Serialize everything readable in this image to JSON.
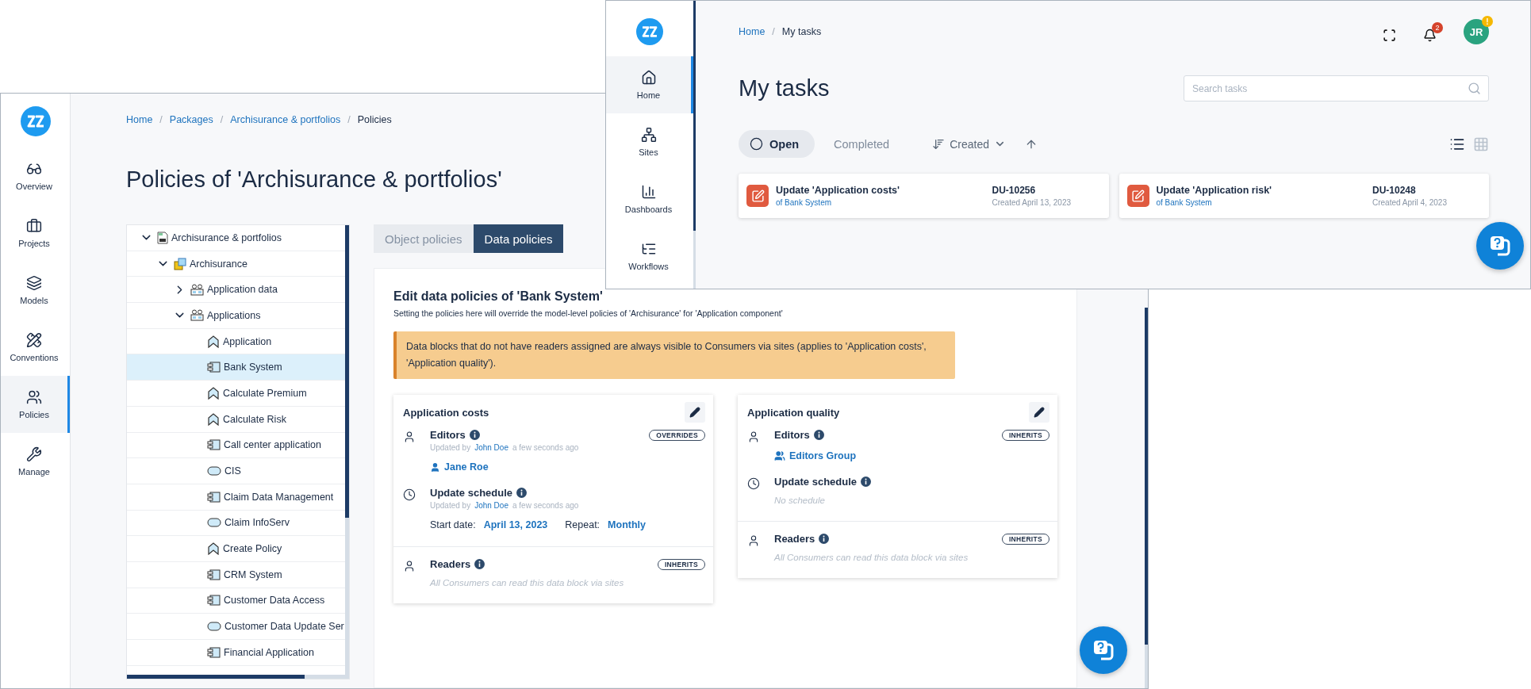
{
  "back_window": {
    "sidebar": {
      "items": [
        {
          "label": "Overview",
          "selected": false
        },
        {
          "label": "Projects",
          "selected": false
        },
        {
          "label": "Models",
          "selected": false
        },
        {
          "label": "Conventions",
          "selected": false
        },
        {
          "label": "Policies",
          "selected": true
        },
        {
          "label": "Manage",
          "selected": false
        }
      ]
    },
    "breadcrumb": {
      "separator": "/",
      "items": [
        "Home",
        "Packages",
        "Archisurance & portfolios",
        "Policies"
      ]
    },
    "title": "Policies of 'Archisurance & portfolios'",
    "tree": [
      {
        "label": "Archisurance & portfolios",
        "kind": "package",
        "expanded": true,
        "selected": false,
        "children": [
          {
            "label": "Archisurance",
            "kind": "model",
            "expanded": true,
            "selected": false,
            "children": [
              {
                "label": "Application data",
                "kind": "folder",
                "expanded": false,
                "selected": false
              },
              {
                "label": "Applications",
                "kind": "folder",
                "expanded": true,
                "selected": false,
                "children": [
                  {
                    "label": "Application",
                    "kind": "function",
                    "selected": false
                  },
                  {
                    "label": "Bank System",
                    "kind": "component",
                    "selected": true
                  },
                  {
                    "label": "Calculate Premium",
                    "kind": "function",
                    "selected": false
                  },
                  {
                    "label": "Calculate Risk",
                    "kind": "function",
                    "selected": false
                  },
                  {
                    "label": "Call center application",
                    "kind": "component",
                    "selected": false
                  },
                  {
                    "label": "CIS",
                    "kind": "service",
                    "selected": false
                  },
                  {
                    "label": "Claim Data Management",
                    "kind": "component",
                    "selected": false
                  },
                  {
                    "label": "Claim InfoServ",
                    "kind": "service",
                    "selected": false
                  },
                  {
                    "label": "Create Policy",
                    "kind": "function",
                    "selected": false
                  },
                  {
                    "label": "CRM System",
                    "kind": "component",
                    "selected": false
                  },
                  {
                    "label": "Customer Data Access",
                    "kind": "component",
                    "selected": false
                  },
                  {
                    "label": "Customer Data Update Ser",
                    "kind": "service",
                    "selected": false
                  },
                  {
                    "label": "Financial Application",
                    "kind": "component",
                    "selected": false
                  }
                ]
              }
            ]
          }
        ]
      }
    ],
    "tabs": [
      {
        "label": "Object policies",
        "selected": false
      },
      {
        "label": "Data policies",
        "selected": true
      }
    ],
    "editor": {
      "title": "Edit data policies of 'Bank System'",
      "subtitle": "Setting the policies here will override the model-level policies of 'Archisurance' for 'Application component'",
      "warning": "Data blocks that do not have readers assigned are always visible to Consumers via sites (applies to 'Application costs', 'Application quality').",
      "cards": [
        {
          "title": "Application costs",
          "groups": [
            {
              "sections": [
                {
                  "kind": "editors",
                  "label": "Editors",
                  "badge": "OVERRIDES",
                  "updated": {
                    "prefix": "Updated by",
                    "name": "John Doe",
                    "suffix": "a few seconds ago"
                  },
                  "entries": [
                    {
                      "kind": "user",
                      "text": "Jane Roe"
                    }
                  ]
                },
                {
                  "kind": "schedule",
                  "label": "Update schedule",
                  "updated": {
                    "prefix": "Updated by",
                    "name": "John Doe",
                    "suffix": "a few seconds ago"
                  },
                  "fields": [
                    {
                      "label": "Start date:",
                      "value": "April 13, 2023"
                    },
                    {
                      "label": "Repeat:",
                      "value": "Monthly"
                    }
                  ]
                }
              ]
            },
            {
              "sections": [
                {
                  "kind": "readers",
                  "label": "Readers",
                  "badge": "INHERITS",
                  "empty": "All Consumers can read this data block via sites"
                }
              ]
            }
          ]
        },
        {
          "title": "Application quality",
          "groups": [
            {
              "sections": [
                {
                  "kind": "editors",
                  "label": "Editors",
                  "badge": "INHERITS",
                  "entries": [
                    {
                      "kind": "group",
                      "text": "Editors Group"
                    }
                  ]
                },
                {
                  "kind": "schedule",
                  "label": "Update schedule",
                  "empty": "No schedule"
                }
              ]
            },
            {
              "sections": [
                {
                  "kind": "readers",
                  "label": "Readers",
                  "badge": "INHERITS",
                  "empty": "All Consumers can read this data block via sites"
                }
              ]
            }
          ]
        }
      ]
    }
  },
  "front_window": {
    "sidebar": {
      "items": [
        {
          "label": "Home",
          "selected": true
        },
        {
          "label": "Sites",
          "selected": false
        },
        {
          "label": "Dashboards",
          "selected": false
        },
        {
          "label": "Workflows",
          "selected": false
        }
      ]
    },
    "breadcrumb": {
      "separator": "/",
      "items": [
        "Home",
        "My tasks"
      ]
    },
    "notifications": "2",
    "avatar": {
      "initials": "JR",
      "alert": "!"
    },
    "title": "My tasks",
    "search": {
      "placeholder": "Search tasks"
    },
    "filters": [
      {
        "label": "Open",
        "selected": true
      },
      {
        "label": "Completed",
        "selected": false
      }
    ],
    "sort": {
      "label": "Created"
    },
    "view_modes": [
      {
        "selected": true
      },
      {
        "selected": false
      }
    ],
    "tasks": [
      {
        "title": "Update 'Application costs'",
        "subtitle": "of Bank System",
        "id": "DU-10256",
        "created": "Created April 13, 2023"
      },
      {
        "title": "Update 'Application risk'",
        "subtitle": "of Bank System",
        "id": "DU-10248",
        "created": "Created April 4, 2023"
      }
    ]
  }
}
